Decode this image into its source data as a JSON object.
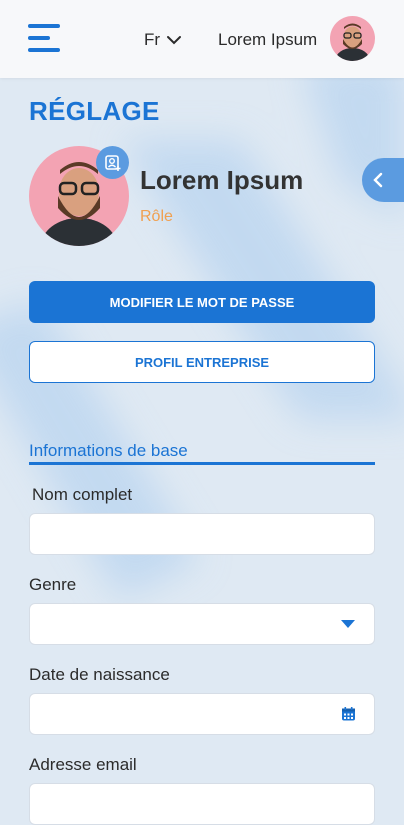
{
  "header": {
    "language": "Fr",
    "user_name": "Lorem Ipsum"
  },
  "page": {
    "title": "RÉGLAGE",
    "profile_name": "Lorem Ipsum",
    "profile_role": "Rôle"
  },
  "actions": {
    "change_password": "MODIFIER LE MOT DE PASSE",
    "company_profile": "PROFIL ENTREPRISE"
  },
  "basic_info": {
    "section_title": "Informations de base",
    "full_name_label": "Nom complet",
    "full_name_value": "",
    "gender_label": "Genre",
    "gender_value": "",
    "birthdate_label": "Date de naissance",
    "birthdate_value": "",
    "email_label": "Adresse email"
  },
  "colors": {
    "primary": "#1b74d4",
    "accent_role": "#f0a050",
    "tab_blue": "#5b9be0"
  },
  "icons": [
    "menu-icon",
    "chevron-down-icon",
    "add-photo-icon",
    "chevron-left-icon",
    "dropdown-caret-icon",
    "calendar-icon"
  ]
}
